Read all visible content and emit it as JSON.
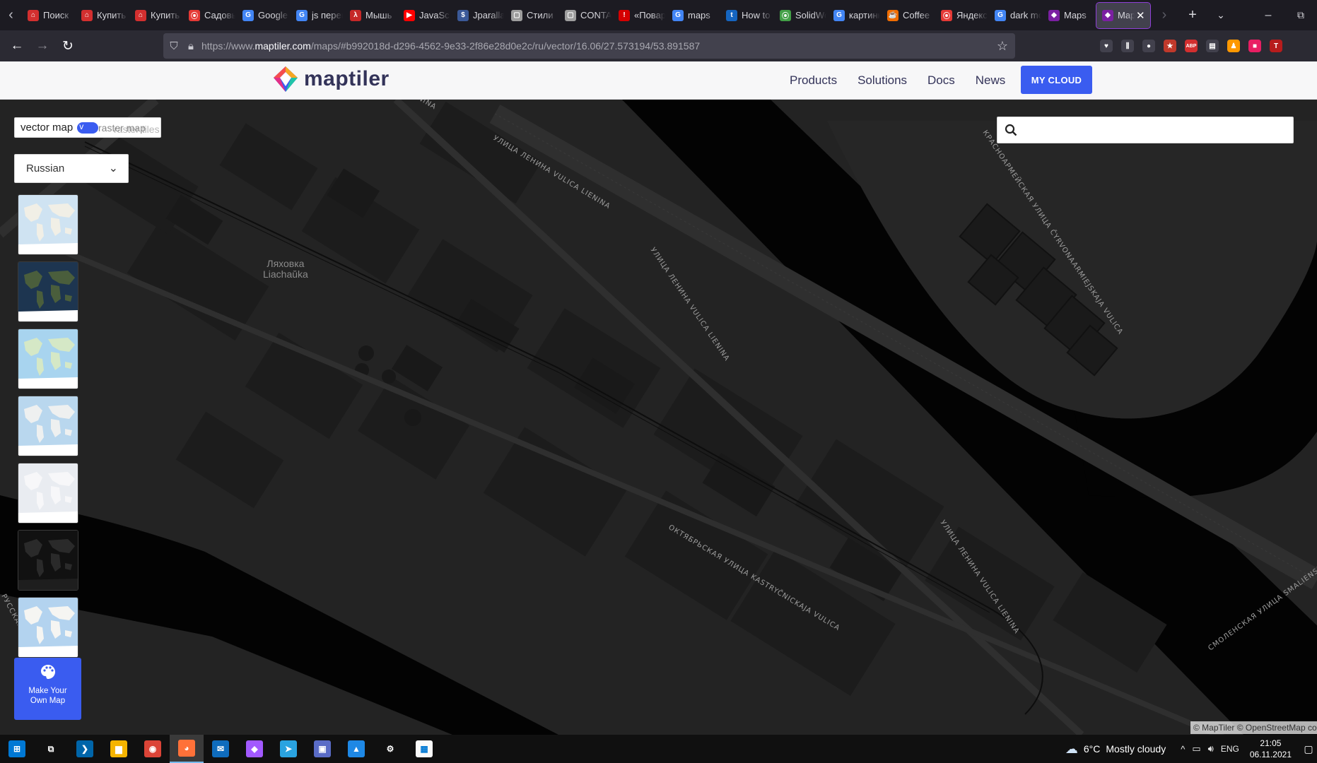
{
  "browser": {
    "tabs": [
      {
        "label": "Поиск",
        "fav_color": "#d32f2f",
        "fav_glyph": "⌂"
      },
      {
        "label": "Купить",
        "fav_color": "#d32f2f",
        "fav_glyph": "⌂"
      },
      {
        "label": "Купить",
        "fav_color": "#d32f2f",
        "fav_glyph": "⌂"
      },
      {
        "label": "Садовый",
        "fav_color": "#e53935",
        "fav_glyph": "⦿"
      },
      {
        "label": "Google",
        "fav_color": "#4285f4",
        "fav_glyph": "G"
      },
      {
        "label": "js перевод",
        "fav_color": "#4285f4",
        "fav_glyph": "G"
      },
      {
        "label": "Мышь",
        "fav_color": "#c62828",
        "fav_glyph": "λ"
      },
      {
        "label": "JavaScript",
        "fav_color": "#ff0000",
        "fav_glyph": "▶"
      },
      {
        "label": "Jparallax",
        "fav_color": "#3b5998",
        "fav_glyph": "$"
      },
      {
        "label": "Стили",
        "fav_color": "#9e9e9e",
        "fav_glyph": "▢"
      },
      {
        "label": "CONTACT",
        "fav_color": "#9e9e9e",
        "fav_glyph": "▢"
      },
      {
        "label": "«Повар",
        "fav_color": "#d50000",
        "fav_glyph": "!"
      },
      {
        "label": "maps",
        "fav_color": "#4285f4",
        "fav_glyph": "G"
      },
      {
        "label": "How to",
        "fav_color": "#1565c0",
        "fav_glyph": "t"
      },
      {
        "label": "SolidWorks",
        "fav_color": "#43a047",
        "fav_glyph": "⦿"
      },
      {
        "label": "картинки",
        "fav_color": "#4285f4",
        "fav_glyph": "G"
      },
      {
        "label": "Coffee",
        "fav_color": "#ef6c00",
        "fav_glyph": "☕"
      },
      {
        "label": "Яндекс",
        "fav_color": "#e53935",
        "fav_glyph": "⦿"
      },
      {
        "label": "dark mode",
        "fav_color": "#4285f4",
        "fav_glyph": "G"
      },
      {
        "label": "Maps",
        "fav_color": "#7b1fa2",
        "fav_glyph": "◆"
      },
      {
        "label": "Maps",
        "fav_color": "#7b1fa2",
        "fav_glyph": "◆",
        "active": true
      }
    ],
    "url_prefix": "https://www.",
    "url_host": "maptiler.com",
    "url_path": "/maps/#b992018d-d296-4562-9e33-2f86e28d0e2c/ru/vector/16.06/27.573194/53.891587",
    "extensions": [
      {
        "name": "pocket",
        "color": "#42414d",
        "glyph": "♥"
      },
      {
        "name": "library",
        "color": "#42414d",
        "glyph": "⫼"
      },
      {
        "name": "account",
        "color": "#42414d",
        "glyph": "●"
      },
      {
        "name": "ext-red",
        "color": "#c0392b",
        "glyph": "★"
      },
      {
        "name": "adblock",
        "color": "#d32f2f",
        "glyph": "ABP"
      },
      {
        "name": "ext-screen",
        "color": "#42414d",
        "glyph": "▤"
      },
      {
        "name": "ext-fox",
        "color": "#ff9800",
        "glyph": "♟"
      },
      {
        "name": "ext-pink",
        "color": "#e91e63",
        "glyph": "■"
      },
      {
        "name": "ext-t",
        "color": "#b71c1c",
        "glyph": "T"
      }
    ]
  },
  "site": {
    "logo_text": "maptiler",
    "nav": [
      "Products",
      "Solutions",
      "Docs",
      "News"
    ],
    "cta": "MY CLOUD"
  },
  "map": {
    "toggle_left": "vector map",
    "toggle_right": "raster map",
    "toggle_right_ghost": "raster tiles",
    "language": "Russian",
    "search_placeholder": "",
    "make_map_label": "Make Your Own Map",
    "place_label_ru": "Ляховка",
    "place_label_lat": "Liachaŭka",
    "streets": [
      "УЛИЦА ЛЕНИНА VULICA LIENINA",
      "УЛИЦА ЛЕНИНА VULICA LIENINA",
      "ОКТЯБРЬСКАЯ УЛИЦА KASTRYČNICKAJA VULICA",
      "УЛИЦА ЛЕНИНА VULICA LIENINA",
      "КРАСНОАРМЕЙСКАЯ УЛИЦА ČYRVONAARMIEJSKAJA VULICA",
      "СМОЛЕНСКАЯ УЛИЦА SMALIENSKAJA",
      "LIENINA",
      "РУССКАЯ"
    ],
    "attribution": "© MapTiler © OpenStreetMap contributors",
    "styles": [
      {
        "name": "streets",
        "bg": "#cfe3f2",
        "land": "#f1efe6"
      },
      {
        "name": "satellite",
        "bg": "#1d3550",
        "land": "#4a5e3c"
      },
      {
        "name": "outdoor",
        "bg": "#a8d4ef",
        "land": "#d5e8c6"
      },
      {
        "name": "basic",
        "bg": "#b9d7ee",
        "land": "#eef0f0"
      },
      {
        "name": "bright",
        "bg": "#e9ecf1",
        "land": "#f7f7f9"
      },
      {
        "name": "dark",
        "bg": "#111111",
        "land": "#2a2a2a"
      },
      {
        "name": "topo",
        "bg": "#b3d3ef",
        "land": "#f5f5f2"
      }
    ]
  },
  "taskbar": {
    "apps": [
      {
        "name": "start",
        "color": "#0078d4",
        "glyph": "⊞"
      },
      {
        "name": "task-view",
        "color": "#101010",
        "glyph": "⧉"
      },
      {
        "name": "vscode",
        "color": "#0065a9",
        "glyph": "❯"
      },
      {
        "name": "explorer",
        "color": "#f5b400",
        "glyph": "▆"
      },
      {
        "name": "chrome",
        "color": "#db4437",
        "glyph": "◉"
      },
      {
        "name": "firefox",
        "color": "#ff7139",
        "glyph": "◕",
        "active": true
      },
      {
        "name": "mail",
        "color": "#0f6cbd",
        "glyph": "✉"
      },
      {
        "name": "figma",
        "color": "#a259ff",
        "glyph": "◆"
      },
      {
        "name": "telegram",
        "color": "#2aa3e0",
        "glyph": "➤"
      },
      {
        "name": "save",
        "color": "#5a6cc6",
        "glyph": "▣"
      },
      {
        "name": "photos",
        "color": "#1e88e5",
        "glyph": "▲"
      },
      {
        "name": "settings",
        "color": "#101010",
        "glyph": "⚙"
      },
      {
        "name": "store",
        "color": "#fafafa",
        "glyph": "▦"
      }
    ],
    "weather_temp": "6°C",
    "weather_text": "Mostly cloudy",
    "lang": "ENG",
    "time": "21:05",
    "date": "06.11.2021"
  }
}
